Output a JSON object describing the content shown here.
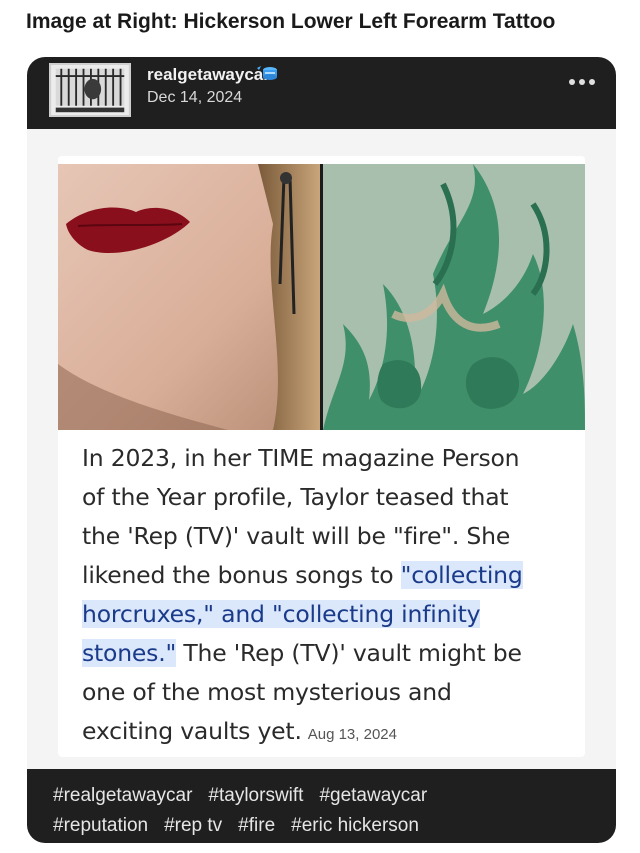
{
  "heading": "Image at Right: Hickerson Lower Left Forearm Tattoo",
  "post": {
    "username": "realgetawaycar",
    "date": "Dec 14, 2024",
    "menu_icon": "more-horizontal-icon",
    "verified_icon": "blue-badge-icon",
    "card": {
      "text_lines": [
        {
          "before": "In 2023, in her TIME magazine Person",
          "highlight": "",
          "after": ""
        },
        {
          "before": "of the Year profile, Taylor teased that",
          "highlight": "",
          "after": ""
        },
        {
          "before": "the 'Rep (TV)' vault will be \"fire\". She",
          "highlight": "",
          "after": ""
        },
        {
          "before": "likened the bonus songs to ",
          "highlight": "\"collecting",
          "after": ""
        },
        {
          "before": "",
          "highlight": "horcruxes,\" and \"collecting infinity",
          "after": ""
        },
        {
          "before": "",
          "highlight": "stones.\"",
          "after": " The 'Rep (TV)' vault might be"
        },
        {
          "before": "one of the most mysterious and",
          "highlight": "",
          "after": ""
        },
        {
          "before": "exciting vaults yet.",
          "highlight": "",
          "after": ""
        }
      ],
      "date": "Aug 13, 2024"
    },
    "tags_row1": [
      "#realgetawaycar",
      "#taylorswift",
      "#getawaycar"
    ],
    "tags_row2": [
      "#reputation",
      "#rep tv",
      "#fire",
      "#eric hickerson"
    ]
  },
  "colors": {
    "post_background": "#1f1f1f",
    "highlight": "#dbe7fb",
    "tattoo_green": "#3f8f6a"
  }
}
